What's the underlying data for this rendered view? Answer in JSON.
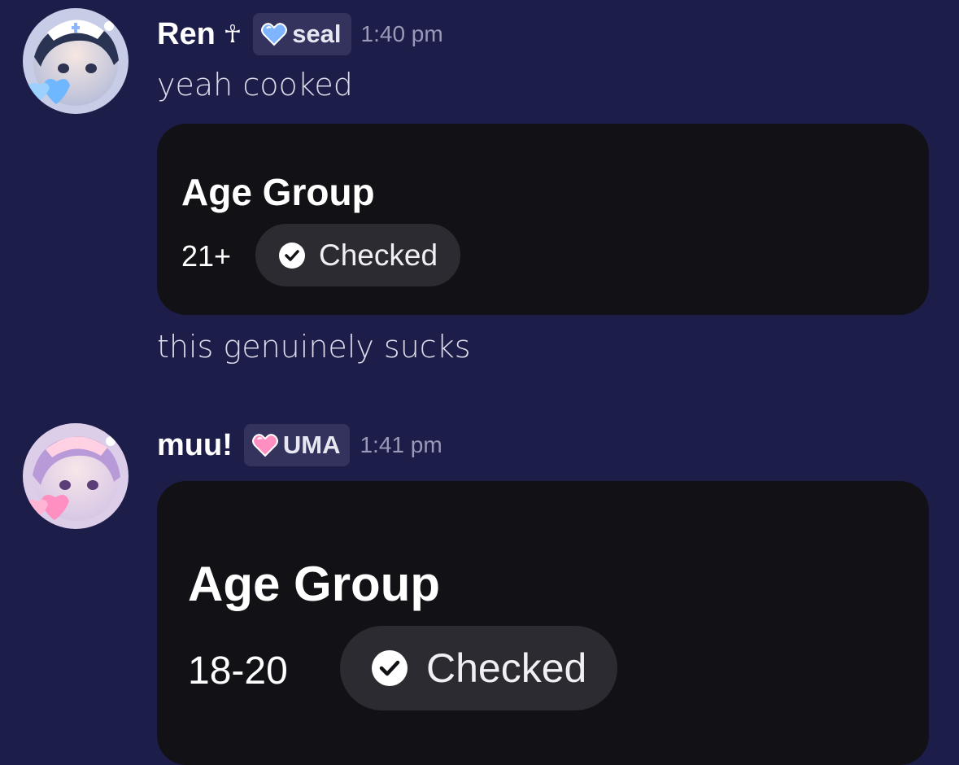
{
  "messages": [
    {
      "username": "Ren",
      "name_glyph": "☥",
      "tag_icon": "blue-heart-icon",
      "tag": "seal",
      "timestamp": "1:40 pm",
      "text": "yeah cooked",
      "card": {
        "title": "Age Group",
        "value": "21+",
        "status": "Checked",
        "status_icon": "check-circle-icon"
      },
      "text_after": "this genuinely sucks",
      "accent": "#7fb4ff"
    },
    {
      "username": "muu!",
      "tag_icon": "pink-heart-icon",
      "tag": "UMA",
      "timestamp": "1:41 pm",
      "card": {
        "title": "Age Group",
        "value": "18-20",
        "status": "Checked",
        "status_icon": "check-circle-icon"
      },
      "accent": "#ff8fc0"
    }
  ],
  "colors": {
    "background": "#1d1d4a",
    "card": "#121116",
    "pill": "#2b2b31",
    "tag": "#33335e"
  }
}
